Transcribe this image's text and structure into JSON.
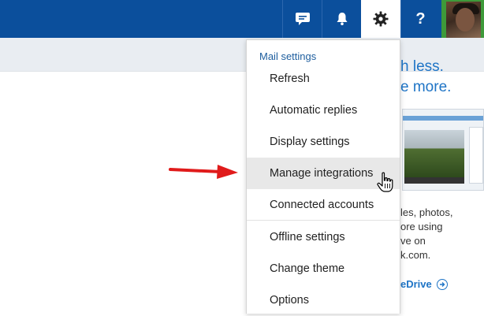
{
  "topbar": {
    "color": "#0b4f9c",
    "buttons": [
      {
        "name": "feedback",
        "icon": "chat-bubble-icon"
      },
      {
        "name": "notifications",
        "icon": "bell-icon"
      },
      {
        "name": "settings",
        "icon": "gear-icon",
        "active": true
      },
      {
        "name": "help",
        "icon": "question-icon",
        "glyph": "?"
      }
    ],
    "avatar": "user-photo"
  },
  "menu": {
    "header": "Mail settings",
    "items": [
      {
        "label": "Refresh"
      },
      {
        "label": "Automatic replies"
      },
      {
        "label": "Display settings"
      },
      {
        "label": "Manage integrations",
        "hovered": true
      },
      {
        "label": "Connected accounts"
      },
      {
        "label": "Offline settings"
      },
      {
        "label": "Change theme"
      },
      {
        "label": "Options"
      }
    ]
  },
  "background_ad": {
    "headline_1": "h less.",
    "headline_2": "e more.",
    "text_lines": [
      "les, photos,",
      "ore using",
      "ve on",
      "k.com."
    ],
    "link": "eDrive",
    "accent": "#1e74c6"
  },
  "annotation": {
    "arrow_color": "#e01b1b"
  }
}
